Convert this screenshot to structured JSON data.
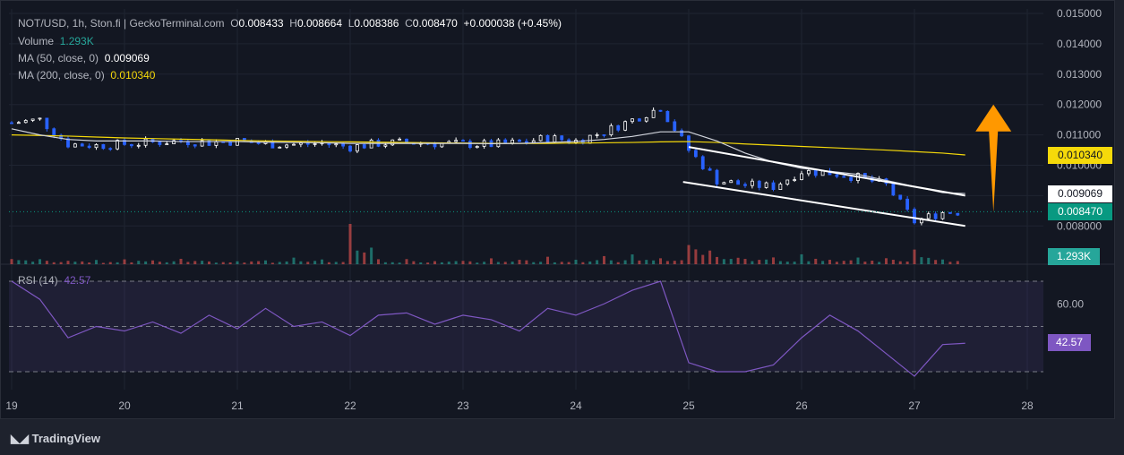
{
  "header": {
    "symbol": "NOT/USD, 1h, Ston.fi | GeckoTerminal.com",
    "o_label": "O",
    "o": "0.008433",
    "h_label": "H",
    "h": "0.008664",
    "l_label": "L",
    "l": "0.008386",
    "c_label": "C",
    "c": "0.008470",
    "change": "+0.000038 (+0.45%)"
  },
  "volume": {
    "label": "Volume",
    "value": "1.293K"
  },
  "ma50": {
    "label": "MA (50, close, 0)",
    "value": "0.009069"
  },
  "ma200": {
    "label": "MA (200, close, 0)",
    "value": "0.010340"
  },
  "rsi": {
    "label": "RSI (14)",
    "value": "42.57"
  },
  "price_tags": {
    "ma200": "0.010340",
    "ma50": "0.009069",
    "last": "0.008470",
    "volume": "1.293K",
    "rsi": "42.57"
  },
  "brand": "TradingView",
  "colors": {
    "up": "#ffffff",
    "down": "#2962ff",
    "ma200": "#f5d90a",
    "ma50": "#d1d4dc",
    "last": "#089981",
    "rsi": "#7e57c2",
    "arrow": "#ff9800",
    "vol_up": "#26a69a",
    "vol_down": "#ef5350"
  },
  "chart_data": {
    "type": "candlestick",
    "y_ticks": [
      "0.015000",
      "0.014000",
      "0.013000",
      "0.012000",
      "0.011000",
      "0.010000",
      "0.009000",
      "0.008000"
    ],
    "ylim": [
      0.0073,
      0.015
    ],
    "x_ticks": [
      "19",
      "20",
      "21",
      "22",
      "23",
      "24",
      "25",
      "26",
      "27",
      "28"
    ],
    "x": [
      19.0,
      19.25,
      19.5,
      19.75,
      20.0,
      20.25,
      20.5,
      20.75,
      21.0,
      21.25,
      21.5,
      21.75,
      22.0,
      22.25,
      22.5,
      22.75,
      23.0,
      23.25,
      23.5,
      23.75,
      24.0,
      24.25,
      24.5,
      24.75,
      25.0,
      25.25,
      25.5,
      25.75,
      26.0,
      26.25,
      26.5,
      26.75,
      27.0,
      27.25,
      27.45
    ],
    "close": [
      0.0114,
      0.0115,
      0.0107,
      0.01065,
      0.0107,
      0.01075,
      0.0108,
      0.01075,
      0.0108,
      0.0107,
      0.01068,
      0.01072,
      0.0106,
      0.01072,
      0.01075,
      0.01072,
      0.0107,
      0.01068,
      0.01075,
      0.0109,
      0.0108,
      0.0111,
      0.0115,
      0.0119,
      0.0105,
      0.0095,
      0.00935,
      0.0093,
      0.0098,
      0.00975,
      0.0096,
      0.00935,
      0.00815,
      0.00845,
      0.00847
    ],
    "ma50": [
      0.0112,
      0.011,
      0.01085,
      0.0108,
      0.0108,
      0.0108,
      0.01078,
      0.01078,
      0.01078,
      0.01076,
      0.01075,
      0.01074,
      0.01072,
      0.01072,
      0.01072,
      0.01072,
      0.01072,
      0.01071,
      0.01072,
      0.01075,
      0.01078,
      0.01085,
      0.01095,
      0.0111,
      0.0111,
      0.0108,
      0.0104,
      0.0101,
      0.0099,
      0.0098,
      0.0097,
      0.0095,
      0.0093,
      0.0091,
      0.009069
    ],
    "ma200": [
      0.011,
      0.01098,
      0.01096,
      0.01093,
      0.0109,
      0.01088,
      0.01086,
      0.01084,
      0.01082,
      0.0108,
      0.01079,
      0.01078,
      0.01077,
      0.01076,
      0.01075,
      0.01074,
      0.01073,
      0.01072,
      0.01072,
      0.01072,
      0.01073,
      0.01074,
      0.01075,
      0.01077,
      0.01078,
      0.01075,
      0.0107,
      0.01066,
      0.01062,
      0.01058,
      0.01054,
      0.0105,
      0.01045,
      0.0104,
      0.01034
    ],
    "volume": [
      1.5,
      1.2,
      1.0,
      0.9,
      1.2,
      1.0,
      1.3,
      1.0,
      1.1,
      1.0,
      1.2,
      0.9,
      8.5,
      1.0,
      1.2,
      1.1,
      1.0,
      1.2,
      1.4,
      1.3,
      1.5,
      1.4,
      2.0,
      1.6,
      5.5,
      2.5,
      1.8,
      1.5,
      2.0,
      1.6,
      1.4,
      1.6,
      2.8,
      1.5,
      1.293
    ],
    "rsi": [
      70,
      62,
      45,
      50,
      48,
      52,
      47,
      55,
      49,
      58,
      50,
      52,
      46,
      55,
      56,
      51,
      55,
      53,
      48,
      58,
      55,
      60,
      66,
      70,
      34,
      30,
      30,
      33,
      45,
      55,
      48,
      38,
      28,
      42,
      42.57
    ],
    "rsi_levels": [
      70,
      50,
      30
    ],
    "rsi_ticks": [
      "60.00"
    ],
    "trendlines": [
      {
        "from": [
          25.0,
          0.0106
        ],
        "to": [
          27.45,
          0.009
        ]
      },
      {
        "from": [
          24.95,
          0.00945
        ],
        "to": [
          27.45,
          0.008
        ]
      }
    ],
    "arrow": {
      "x": 27.7,
      "from": 0.00845,
      "to": 0.012
    }
  }
}
